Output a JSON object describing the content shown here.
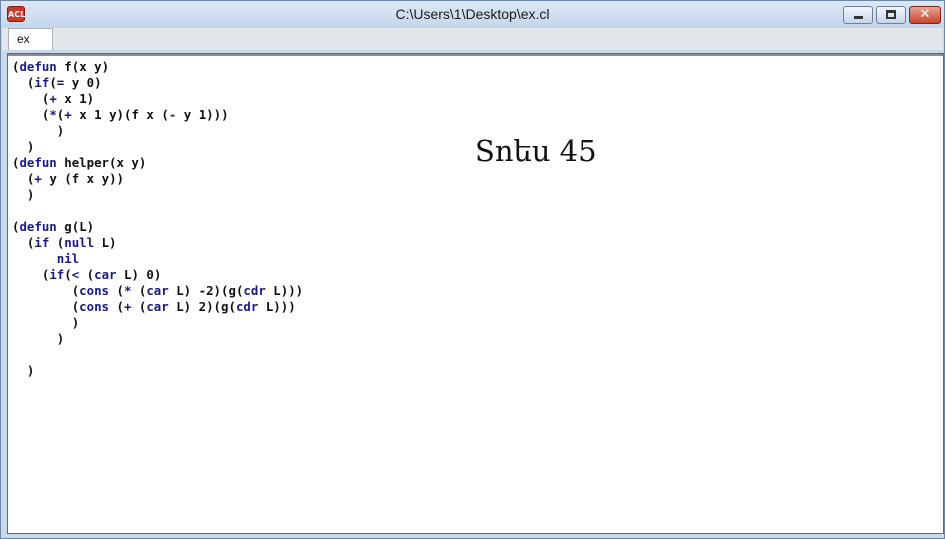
{
  "window": {
    "title": "C:\\Users\\1\\Desktop\\ex.cl",
    "icon": "app-icon",
    "icon_text": "ACL"
  },
  "tabs": [
    {
      "label": "ex"
    }
  ],
  "code_lines": [
    "(defun f(x y)",
    "  (if(= y 0)",
    "    (+ x 1)",
    "    (*(+ x 1 y)(f x (- y 1)))",
    "      )",
    "  )",
    "(defun helper(x y)",
    "  (+ y (f x y))",
    "  )",
    "",
    "(defun g(L)",
    "  (if (null L)",
    "      nil",
    "    (if(< (car L) 0)",
    "        (cons (* (car L) -2)(g(cdr L)))",
    "        (cons (+ (car L) 2)(g(cdr L)))",
    "        )",
    "      )",
    "",
    "  )"
  ],
  "keywords": [
    "defun",
    "if",
    "null",
    "cons",
    "car",
    "cdr",
    "nil"
  ],
  "overlay_text": "Snեu 45"
}
